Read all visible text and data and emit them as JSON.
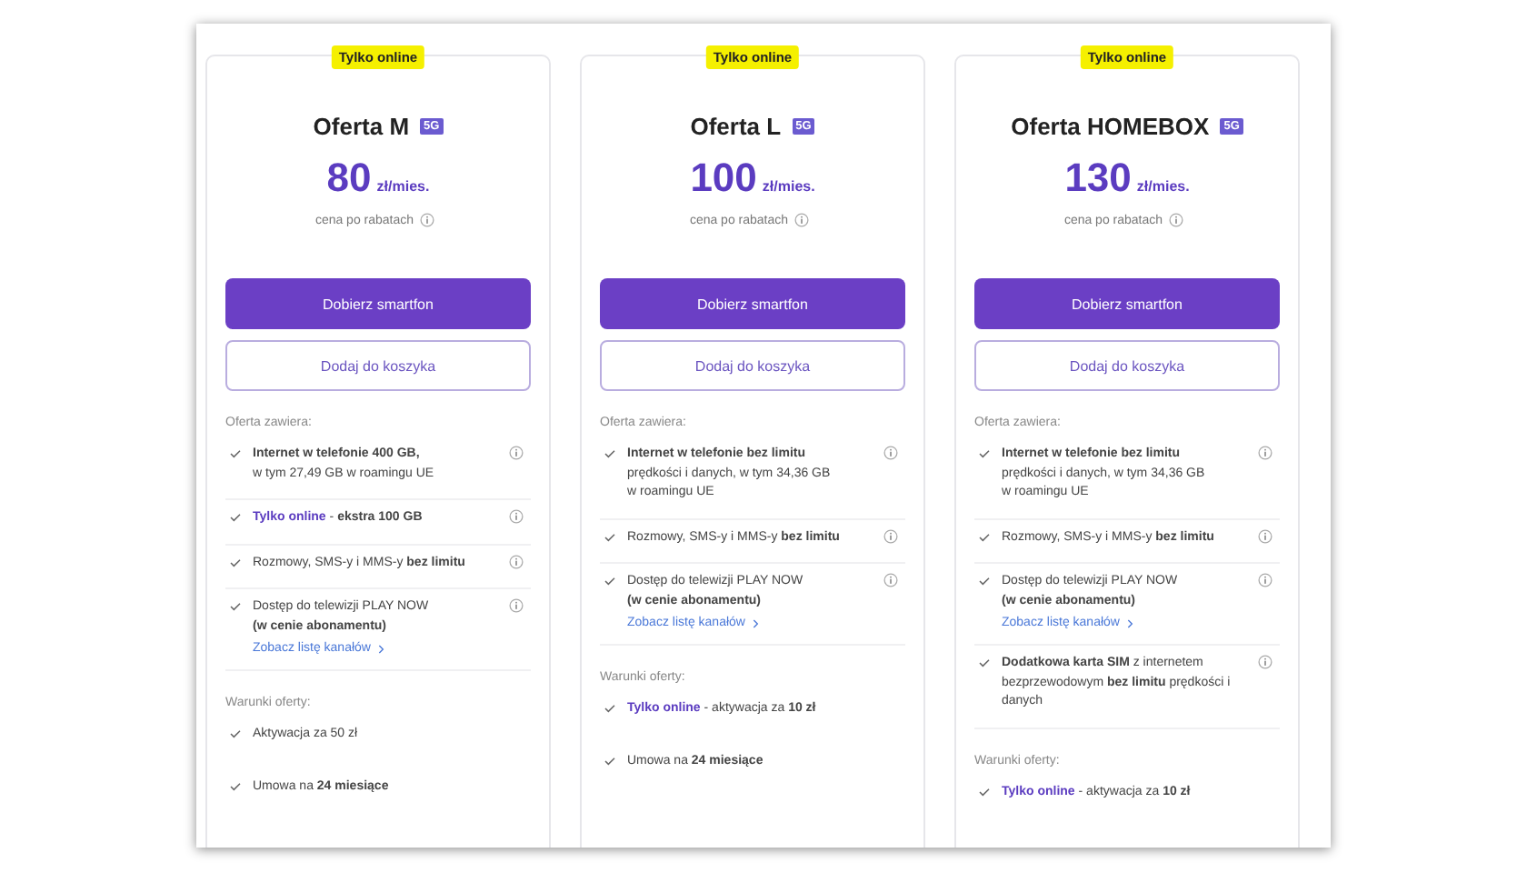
{
  "offers": [
    {
      "badge": "Tylko online",
      "title": "Oferta M",
      "network": "5G",
      "price": "80",
      "unit": "zł/mies.",
      "price_note": "cena po rabatach",
      "primary_button": "Dobierz smartfon",
      "secondary_button": "Dodaj do koszyka",
      "features_heading": "Oferta zawiera:",
      "features": [
        {
          "lines": [
            "**Internet w telefonie 400 GB,**",
            "w tym 27,49 GB w roamingu UE"
          ]
        },
        {
          "highlight": "Tylko online",
          "lines": [
            " - **ekstra 100 GB**"
          ]
        },
        {
          "lines": [
            "Rozmowy, SMS-y i MMS-y **bez limitu**"
          ]
        },
        {
          "lines": [
            "Dostęp do telewizji PLAY NOW",
            "**(w cenie abonamentu)**"
          ],
          "link": "Zobacz listę kanałów"
        }
      ],
      "conditions_heading": "Warunki oferty:",
      "conditions": [
        {
          "lines": [
            "Aktywacja za 50 zł"
          ]
        },
        {
          "lines": [
            "Umowa na **24 miesiące**"
          ]
        }
      ]
    },
    {
      "badge": "Tylko online",
      "title": "Oferta L",
      "network": "5G",
      "price": "100",
      "unit": "zł/mies.",
      "price_note": "cena po rabatach",
      "primary_button": "Dobierz smartfon",
      "secondary_button": "Dodaj do koszyka",
      "features_heading": "Oferta zawiera:",
      "features": [
        {
          "lines": [
            "**Internet w telefonie bez limitu**",
            "prędkości i danych, w tym 34,36 GB",
            "w roamingu UE"
          ]
        },
        {
          "lines": [
            "Rozmowy, SMS-y i MMS-y **bez limitu**"
          ]
        },
        {
          "lines": [
            "Dostęp do telewizji PLAY NOW",
            "**(w cenie abonamentu)**"
          ],
          "link": "Zobacz listę kanałów"
        }
      ],
      "conditions_heading": "Warunki oferty:",
      "conditions": [
        {
          "highlight": "Tylko online",
          "lines": [
            " - aktywacja za **10 zł**"
          ]
        },
        {
          "lines": [
            "Umowa na **24 miesiące**"
          ]
        }
      ]
    },
    {
      "badge": "Tylko online",
      "title": "Oferta HOMEBOX",
      "network": "5G",
      "price": "130",
      "unit": "zł/mies.",
      "price_note": "cena po rabatach",
      "primary_button": "Dobierz smartfon",
      "secondary_button": "Dodaj do koszyka",
      "features_heading": "Oferta zawiera:",
      "features": [
        {
          "lines": [
            "**Internet w telefonie bez limitu**",
            "prędkości i danych, w tym 34,36 GB",
            "w roamingu UE"
          ]
        },
        {
          "lines": [
            "Rozmowy, SMS-y i MMS-y **bez limitu**"
          ]
        },
        {
          "lines": [
            "Dostęp do telewizji PLAY NOW",
            "**(w cenie abonamentu)**"
          ],
          "link": "Zobacz listę kanałów"
        },
        {
          "lines": [
            "**Dodatkowa karta SIM** z internetem",
            "bezprzewodowym **bez limitu** prędkości i",
            "danych"
          ]
        }
      ],
      "conditions_heading": "Warunki oferty:",
      "conditions": [
        {
          "highlight": "Tylko online",
          "lines": [
            " - aktywacja za **10 zł**"
          ]
        }
      ]
    }
  ]
}
